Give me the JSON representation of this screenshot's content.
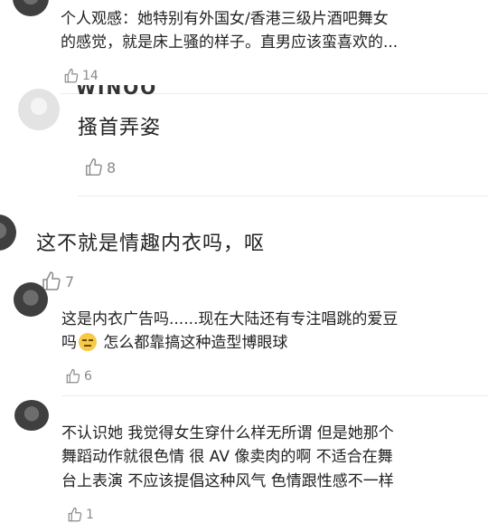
{
  "comments": [
    {
      "text_line1": "个人观感：她特别有外国女/香港三级片酒吧舞女",
      "text_line2": "的感觉，就是床上骚的样子。直男应该蛮喜欢的...",
      "likes": "14"
    },
    {
      "name_partial": "WINOO",
      "text": "搔首弄姿",
      "likes": "8"
    },
    {
      "text": "这不就是情趣内衣吗，呕",
      "likes": "7"
    },
    {
      "text_line1": "这是内衣广告吗......现在大陆还有专注唱跳的爱豆",
      "text_line2_pre": "吗",
      "emoji": "embarrassed-emoji",
      "text_line2_post": " 怎么都靠搞这种造型博眼球",
      "likes": "6"
    },
    {
      "text_line1": "不认识她 我觉得女生穿什么样无所谓 但是她那个",
      "text_line2": "舞蹈动作就很色情 很 AV 像卖肉的啊 不适合在舞",
      "text_line3": "台上表演 不应该提倡这种风气 色情跟性感不一样",
      "likes": "1"
    }
  ],
  "colors": {
    "text": "#222222",
    "meta": "#8a8a8a",
    "divider": "#ececec",
    "emoji": "#f7c948"
  }
}
